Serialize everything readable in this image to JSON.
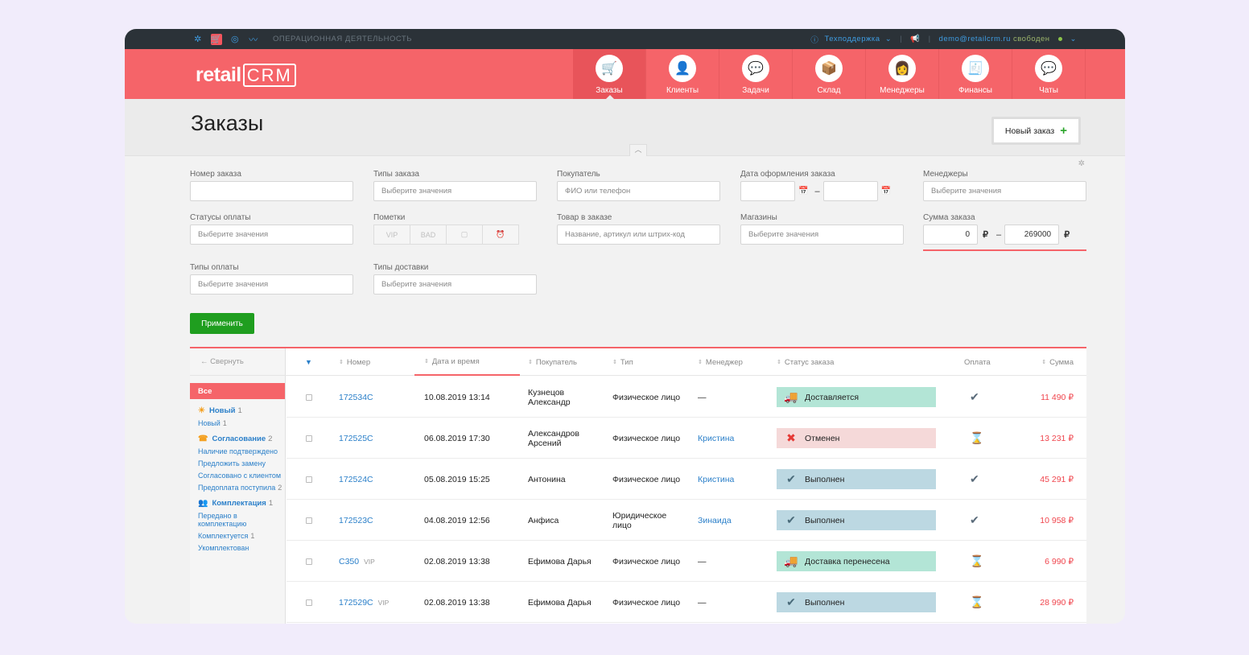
{
  "topbar": {
    "section": "ОПЕРАЦИОННАЯ ДЕЯТЕЛЬНОСТЬ",
    "support": "Техподдержка",
    "user": "demo@retailcrm.ru",
    "user_status": "свободен"
  },
  "logo": {
    "retail": "retail",
    "crm": "CRM"
  },
  "nav": [
    {
      "label": "Заказы",
      "icon": "cart-icon",
      "color": "#3e9be0",
      "glyph": "🛒"
    },
    {
      "label": "Клиенты",
      "icon": "client-icon",
      "color": "#f4923a",
      "glyph": "👤"
    },
    {
      "label": "Задачи",
      "icon": "tasks-icon",
      "color": "#5b7fd6",
      "glyph": "💬"
    },
    {
      "label": "Склад",
      "icon": "warehouse-icon",
      "color": "#e8b640",
      "glyph": "📦"
    },
    {
      "label": "Менеджеры",
      "icon": "manager-icon",
      "color": "#e67a3c",
      "glyph": "👩"
    },
    {
      "label": "Финансы",
      "icon": "finance-icon",
      "color": "#e9e9e9",
      "glyph": "🧾"
    },
    {
      "label": "Чаты",
      "icon": "chat-icon",
      "color": "#6ec07a",
      "glyph": "💬"
    }
  ],
  "page": {
    "title": "Заказы",
    "new_order": "Новый заказ",
    "plus": "+"
  },
  "filters": {
    "order_number": {
      "label": "Номер заказа",
      "value": ""
    },
    "order_types": {
      "label": "Типы заказа",
      "placeholder": "Выберите значения"
    },
    "customer": {
      "label": "Покупатель",
      "placeholder": "ФИО или телефон"
    },
    "order_date": {
      "label": "Дата оформления заказа",
      "dash": "–"
    },
    "managers": {
      "label": "Менеджеры",
      "placeholder": "Выберите значения"
    },
    "payment_statuses": {
      "label": "Статусы оплаты",
      "placeholder": "Выберите значения"
    },
    "marks": {
      "label": "Пометки",
      "items": [
        "VIP",
        "BAD",
        "▢",
        "⏰"
      ]
    },
    "product": {
      "label": "Товар в заказе",
      "placeholder": "Название, артикул или штрих-код"
    },
    "shops": {
      "label": "Магазины",
      "placeholder": "Выберите значения"
    },
    "sum": {
      "label": "Сумма заказа",
      "from": "0",
      "to": "269000",
      "currency": "₽",
      "dash": "–"
    },
    "payment_types": {
      "label": "Типы оплаты",
      "placeholder": "Выберите значения"
    },
    "delivery_types": {
      "label": "Типы доставки",
      "placeholder": "Выберите значения"
    },
    "apply": "Применить"
  },
  "sidebar": {
    "collapse": "← Свернуть",
    "all": "Все",
    "groups": [
      {
        "label": "Новый",
        "count": "1",
        "icon": "sun-icon",
        "glyph": "☀",
        "color": "#f4a020",
        "items": [
          {
            "label": "Новый",
            "count": "1"
          }
        ]
      },
      {
        "label": "Согласование",
        "count": "2",
        "icon": "phone-icon",
        "glyph": "☎",
        "color": "#f4a020",
        "items": [
          {
            "label": "Наличие подтверждено",
            "count": ""
          },
          {
            "label": "Предложить замену",
            "count": ""
          },
          {
            "label": "Согласовано с клиентом",
            "count": ""
          },
          {
            "label": "Предоплата поступила",
            "count": "2"
          }
        ]
      },
      {
        "label": "Комплектация",
        "count": "1",
        "icon": "people-icon",
        "glyph": "👥",
        "color": "#6ab04c",
        "items": [
          {
            "label": "Передано в комплектацию",
            "count": ""
          },
          {
            "label": "Комплектуется",
            "count": "1"
          },
          {
            "label": "Укомплектован",
            "count": ""
          }
        ]
      }
    ]
  },
  "table": {
    "columns": [
      "Номер",
      "Дата и время",
      "Покупатель",
      "Тип",
      "Менеджер",
      "Статус заказа",
      "Оплата",
      "Сумма"
    ],
    "rows": [
      {
        "number": "172534C",
        "vip": "",
        "date": "10.08.2019 13:14",
        "customer": "Кузнецов Александр",
        "type": "Физическое лицо",
        "manager": "—",
        "status": "Доставляется",
        "status_kind": "green",
        "status_glyph": "🚚",
        "pay_glyph": "✔",
        "pay_kind": "check",
        "sum": "11 490 ₽"
      },
      {
        "number": "172525C",
        "vip": "",
        "date": "06.08.2019 17:30",
        "customer": "Александров Арсений",
        "type": "Физическое лицо",
        "manager": "Кристина",
        "status": "Отменен",
        "status_kind": "red",
        "status_glyph": "✖",
        "pay_glyph": "⌛",
        "pay_kind": "hour",
        "sum": "13 231 ₽"
      },
      {
        "number": "172524C",
        "vip": "",
        "date": "05.08.2019 15:25",
        "customer": "Антонина",
        "type": "Физическое лицо",
        "manager": "Кристина",
        "status": "Выполнен",
        "status_kind": "blue",
        "status_glyph": "✔",
        "pay_glyph": "✔",
        "pay_kind": "partial",
        "sum": "45 291 ₽"
      },
      {
        "number": "172523C",
        "vip": "",
        "date": "04.08.2019 12:56",
        "customer": "Анфиса",
        "type": "Юридическое лицо",
        "manager": "Зинаида",
        "status": "Выполнен",
        "status_kind": "blue",
        "status_glyph": "✔",
        "pay_glyph": "✔",
        "pay_kind": "check",
        "sum": "10 958 ₽"
      },
      {
        "number": "C350",
        "vip": "VIP",
        "date": "02.08.2019 13:38",
        "customer": "Ефимова Дарья",
        "type": "Физическое лицо",
        "manager": "—",
        "status": "Доставка перенесена",
        "status_kind": "green",
        "status_glyph": "🚚",
        "pay_glyph": "⌛",
        "pay_kind": "hour",
        "sum": "6 990 ₽"
      },
      {
        "number": "172529C",
        "vip": "VIP",
        "date": "02.08.2019 13:38",
        "customer": "Ефимова Дарья",
        "type": "Физическое лицо",
        "manager": "—",
        "status": "Выполнен",
        "status_kind": "blue",
        "status_glyph": "✔",
        "pay_glyph": "⌛",
        "pay_kind": "hour",
        "sum": "28 990 ₽"
      }
    ]
  }
}
